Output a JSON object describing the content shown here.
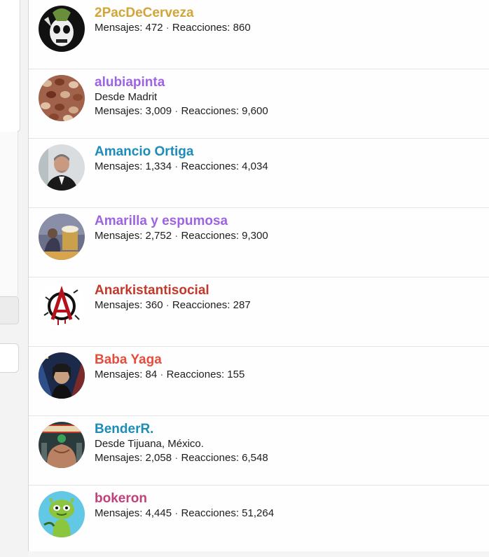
{
  "members": [
    {
      "name": "2PacDeCerveza",
      "color": "#d2a538",
      "location": "",
      "messages_label": "Mensajes:",
      "messages": "472",
      "separator": "·",
      "reactions_label": "Reacciones:",
      "reactions": "860",
      "avatar_icon": "skull-avatar-icon"
    },
    {
      "name": "alubiapinta",
      "color": "#9d63e4",
      "location": "Desde Madrit",
      "messages_label": "Mensajes:",
      "messages": "3,009",
      "separator": "·",
      "reactions_label": "Reacciones:",
      "reactions": "9,600",
      "avatar_icon": "beans-avatar-icon"
    },
    {
      "name": "Amancio Ortiga",
      "color": "#1d8cb8",
      "location": "",
      "messages_label": "Mensajes:",
      "messages": "1,334",
      "separator": "·",
      "reactions_label": "Reacciones:",
      "reactions": "4,034",
      "avatar_icon": "man-portrait-avatar-icon"
    },
    {
      "name": "Amarilla y espumosa",
      "color": "#9d63e4",
      "location": "",
      "messages_label": "Mensajes:",
      "messages": "2,752",
      "separator": "·",
      "reactions_label": "Reacciones:",
      "reactions": "9,300",
      "avatar_icon": "scene-avatar-icon"
    },
    {
      "name": "Anarkistantisocial",
      "color": "#c0392b",
      "location": "",
      "messages_label": "Mensajes:",
      "messages": "360",
      "separator": "·",
      "reactions_label": "Reacciones:",
      "reactions": "287",
      "avatar_icon": "anarchy-avatar-icon"
    },
    {
      "name": "Baba Yaga",
      "color": "#e74c3c",
      "location": "",
      "messages_label": "Mensajes:",
      "messages": "84",
      "separator": "·",
      "reactions_label": "Reacciones:",
      "reactions": "155",
      "avatar_icon": "poster-avatar-icon"
    },
    {
      "name": "BenderR.",
      "color": "#1d8cb8",
      "location": "Desde Tijuana, México.",
      "messages_label": "Mensajes:",
      "messages": "2,058",
      "separator": "·",
      "reactions_label": "Reacciones:",
      "reactions": "6,548",
      "avatar_icon": "bodybuilder-avatar-icon"
    },
    {
      "name": "bokeron",
      "color": "#c0417a",
      "location": "",
      "messages_label": "Mensajes:",
      "messages": "4,445",
      "separator": "·",
      "reactions_label": "Reacciones:",
      "reactions": "51,264",
      "avatar_icon": "alien-avatar-icon"
    }
  ]
}
